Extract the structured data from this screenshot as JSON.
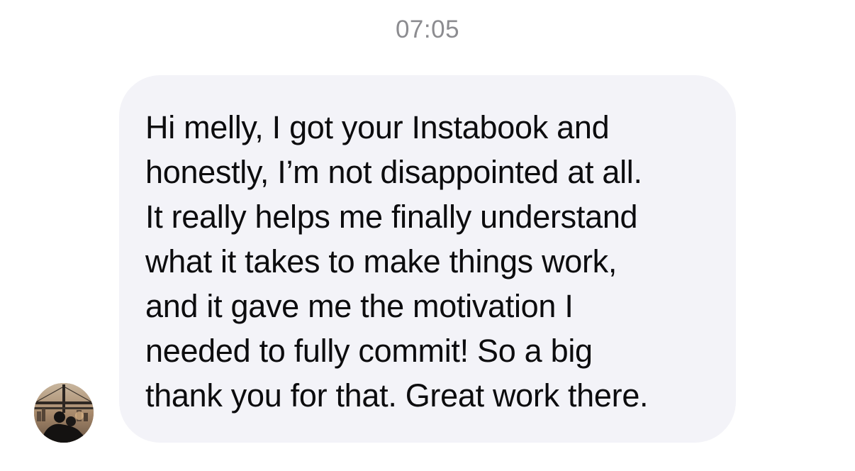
{
  "timestamp": "07:05",
  "message": {
    "lines": [
      "Hi melly, I got your Instabook and",
      "honestly, I’m not disappointed at all.",
      "It really helps me finally understand",
      "what it takes to make things work,",
      "and it gave me the motivation I",
      "needed to fully commit! So a big",
      "thank you for that. Great work there."
    ]
  },
  "avatar": {
    "icon": "profile-photo-avatar"
  }
}
